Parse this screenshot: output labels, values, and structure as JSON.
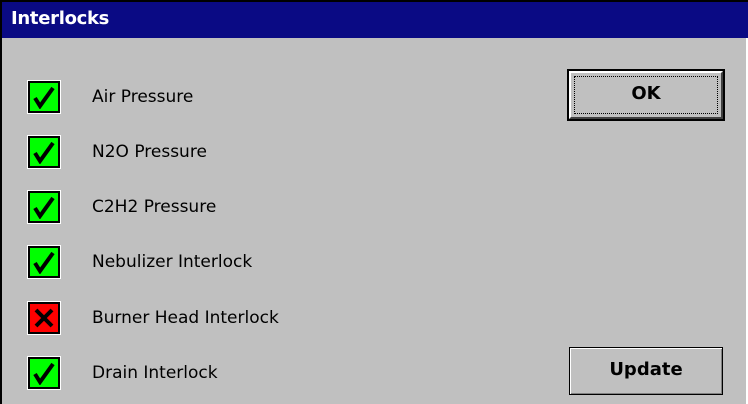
{
  "window": {
    "title": "Interlocks"
  },
  "colors": {
    "titlebar": "#0a0a84",
    "background": "#c0c0c0",
    "status_ok": "#00ff00",
    "status_fail": "#ff0000"
  },
  "interlocks": [
    {
      "label": "Air Pressure",
      "status": "ok",
      "icon": "check-icon"
    },
    {
      "label": "N2O Pressure",
      "status": "ok",
      "icon": "check-icon"
    },
    {
      "label": "C2H2 Pressure",
      "status": "ok",
      "icon": "check-icon"
    },
    {
      "label": "Nebulizer Interlock",
      "status": "ok",
      "icon": "check-icon"
    },
    {
      "label": "Burner Head Interlock",
      "status": "fail",
      "icon": "x-icon"
    },
    {
      "label": "Drain Interlock",
      "status": "ok",
      "icon": "check-icon"
    }
  ],
  "buttons": {
    "ok_label": "OK",
    "update_label": "Update"
  }
}
